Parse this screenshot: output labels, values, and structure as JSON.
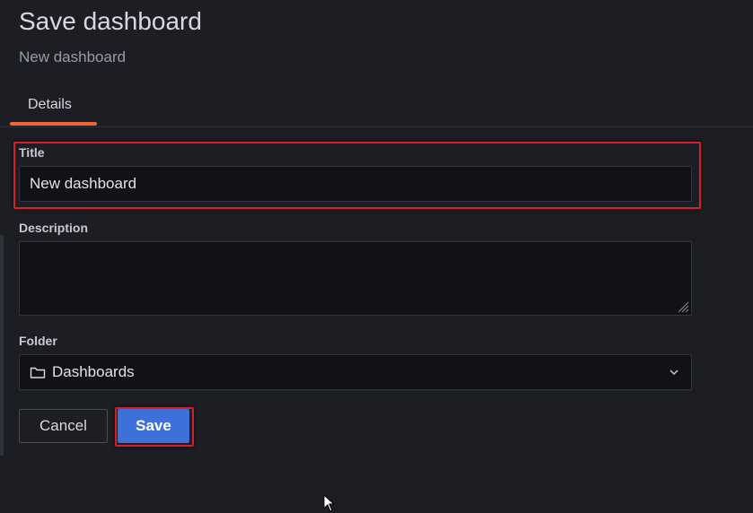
{
  "dialog": {
    "title": "Save dashboard",
    "subtitle": "New dashboard"
  },
  "tabs": [
    {
      "label": "Details",
      "active": true
    }
  ],
  "form": {
    "title_label": "Title",
    "title_value": "New dashboard",
    "description_label": "Description",
    "description_value": "",
    "folder_label": "Folder",
    "folder_value": "Dashboards"
  },
  "buttons": {
    "cancel_label": "Cancel",
    "save_label": "Save"
  },
  "icons": {
    "folder": "folder-icon",
    "chevron": "chevron-down-icon",
    "resize": "resize-grip-icon",
    "cursor": "mouse-cursor-icon"
  },
  "colors": {
    "background": "#1c1e23",
    "input_background": "#111217",
    "accent_tab": "#f2653a",
    "primary_button": "#3d71d9",
    "highlight": "#d6202a"
  }
}
